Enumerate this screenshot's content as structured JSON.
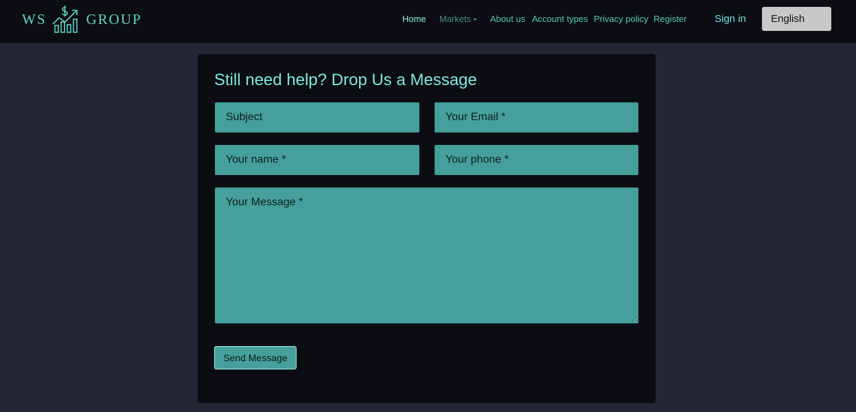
{
  "header": {
    "logo": {
      "left_text": "WS",
      "right_text": "GROUP",
      "icon": "chart-dollar-icon"
    },
    "nav": {
      "home": "Home",
      "markets": "Markets",
      "about": "About us",
      "account_types": "Account types",
      "privacy": "Privacy policy",
      "register": "Register"
    },
    "sign_in": "Sign in",
    "language": "English"
  },
  "contact_form": {
    "title": "Still need help? Drop Us a Message",
    "subject_placeholder": "Subject",
    "email_placeholder": "Your Email *",
    "name_placeholder": "Your name *",
    "phone_placeholder": "Your phone *",
    "message_placeholder": "Your Message *",
    "send_label": "Send Message"
  },
  "colors": {
    "page_bg": "#222733",
    "panel_bg": "#0b0d12",
    "field_bg": "#45a09b",
    "accent": "#7de8e0"
  }
}
